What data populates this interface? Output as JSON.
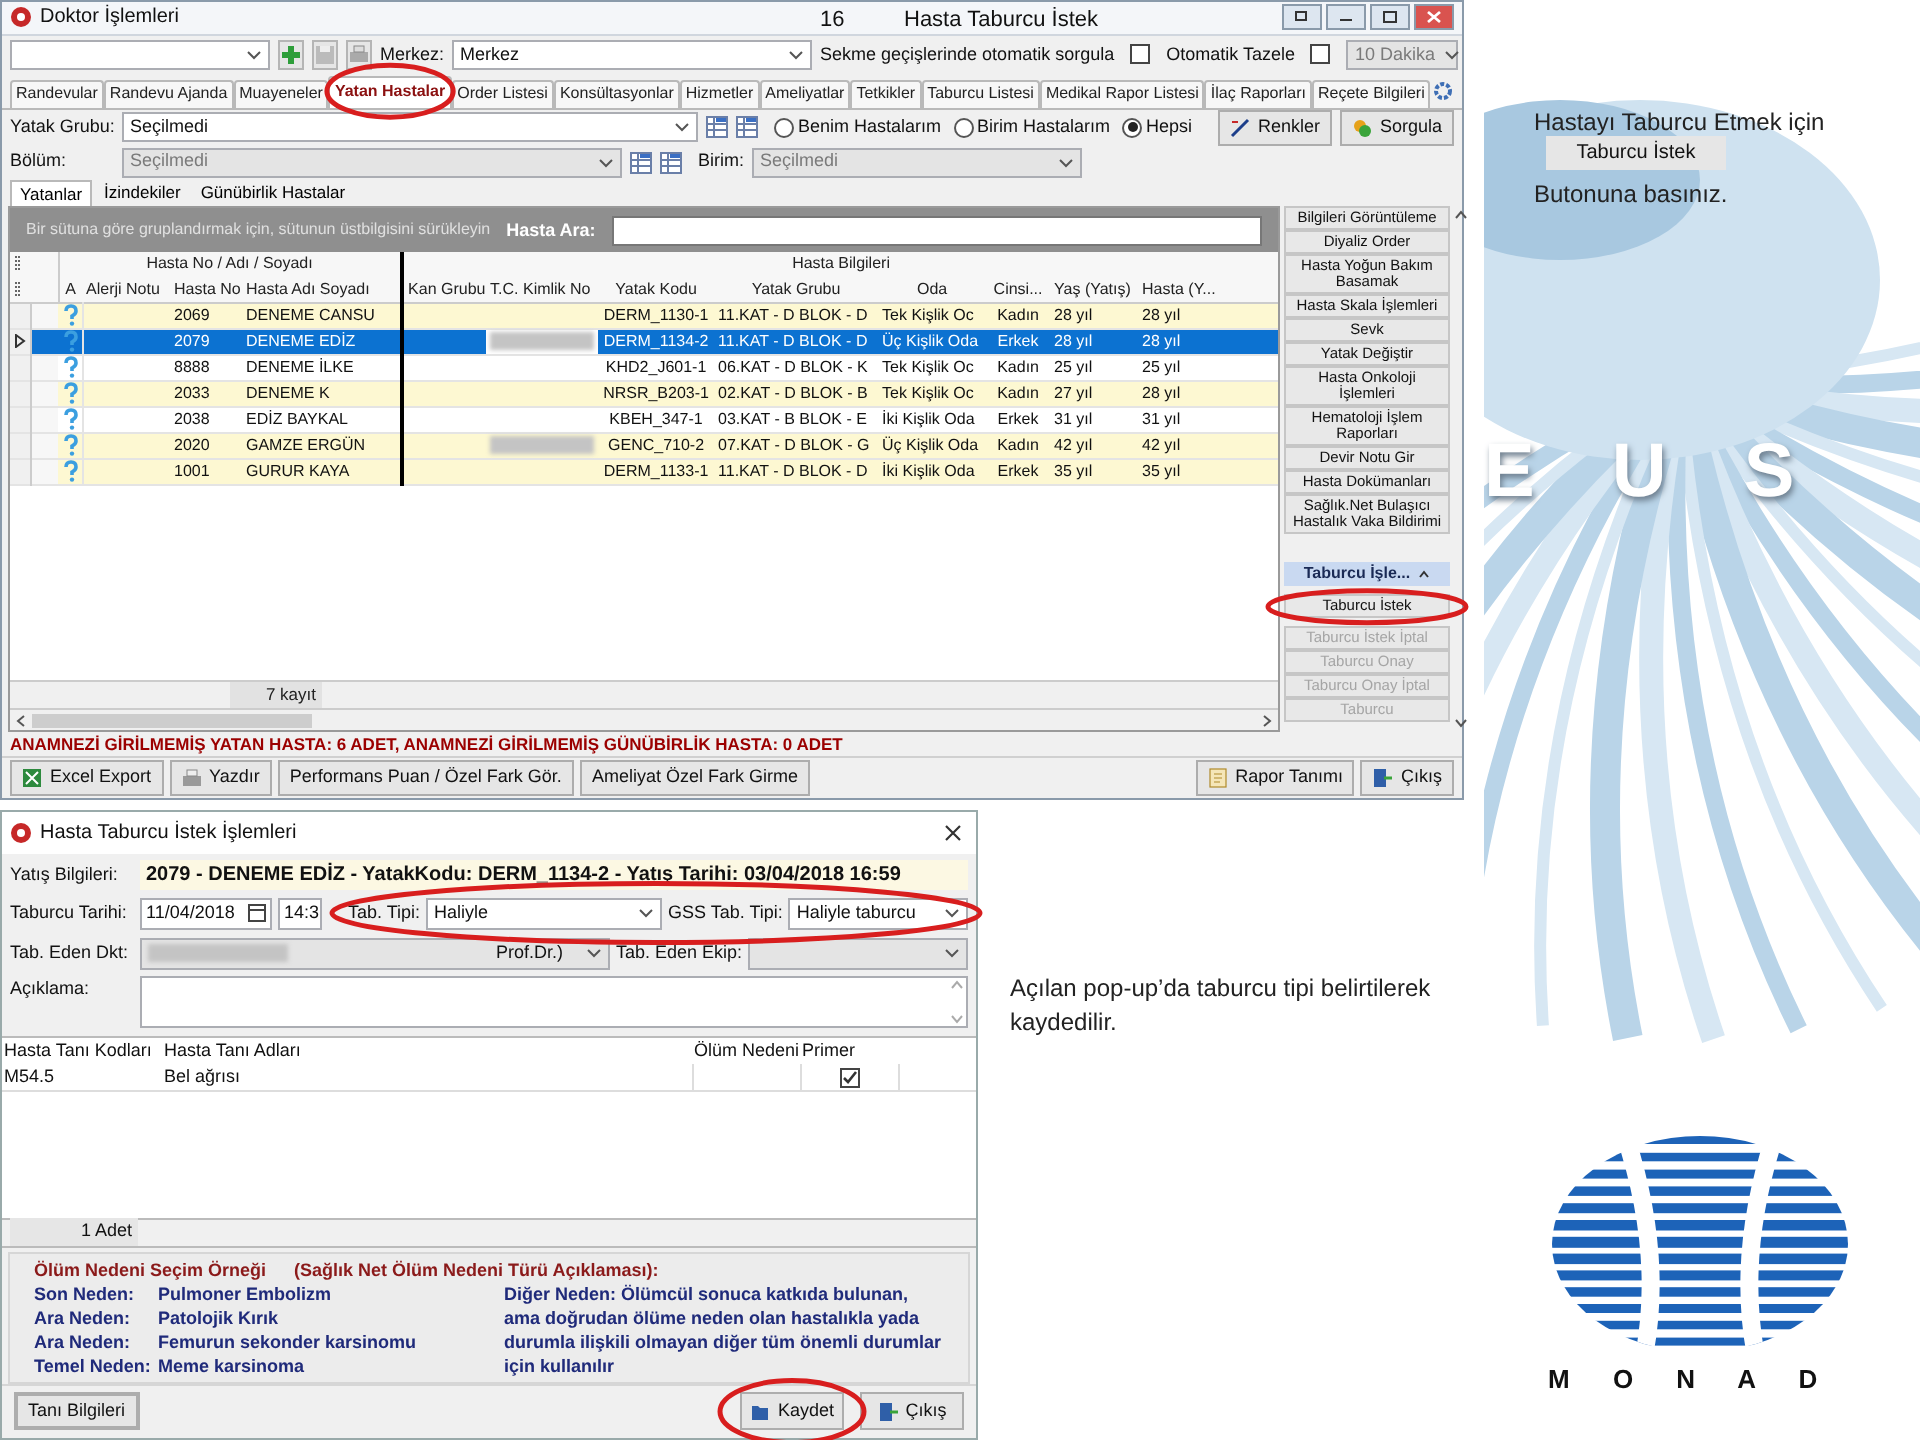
{
  "slide": {
    "page_number": "16",
    "title": "Hasta Taburcu İstek",
    "background_text": "E U S"
  },
  "main_window": {
    "title": "Doktor İşlemleri",
    "toolbar": {
      "merkez_label": "Merkez:",
      "merkez_value": "Merkez",
      "options": [
        {
          "label": "Sekme geçişlerinde otomatik sorgula",
          "checked": false
        },
        {
          "label": "Otomatik Tazele",
          "checked": false
        }
      ],
      "interval": {
        "value": "10 Dakika",
        "disabled": true
      }
    },
    "tabs": [
      {
        "label": "Randevular",
        "selected": false
      },
      {
        "label": "Randevu Ajanda",
        "selected": false
      },
      {
        "label": "Muayeneler",
        "selected": false
      },
      {
        "label": "Yatan Hastalar",
        "selected": true
      },
      {
        "label": "Order Listesi",
        "selected": false
      },
      {
        "label": "Konsültasyonlar",
        "selected": false
      },
      {
        "label": "Hizmetler",
        "selected": false
      },
      {
        "label": "Ameliyatlar",
        "selected": false
      },
      {
        "label": "Tetkikler",
        "selected": false
      },
      {
        "label": "Taburcu Listesi",
        "selected": false
      },
      {
        "label": "Medikal Rapor Listesi",
        "selected": false
      },
      {
        "label": "İlaç Raporları",
        "selected": false
      },
      {
        "label": "Reçete Bilgileri",
        "selected": false
      }
    ],
    "filters": {
      "yatak_grubu_label": "Yatak Grubu:",
      "yatak_grubu_value": "Seçilmedi",
      "radios": [
        {
          "label": "Benim Hastalarım",
          "selected": false
        },
        {
          "label": "Birim Hastalarım",
          "selected": false
        },
        {
          "label": "Hepsi",
          "selected": true
        }
      ],
      "buttons": [
        "Renkler",
        "Sorgula"
      ],
      "bolum_label": "Bölüm:",
      "bolum_value": "Seçilmedi",
      "birim_label": "Birim:",
      "birim_value": "Seçilmedi"
    },
    "sub_tabs": [
      {
        "label": "Yatanlar",
        "selected": true
      },
      {
        "label": "İzindekiler",
        "selected": false
      },
      {
        "label": "Günübirlik Hastalar",
        "selected": false
      }
    ],
    "grid": {
      "group_hint": "Bir sütuna göre gruplandırmak için, sütunun üstbilgisini sürükleyin",
      "search_label": "Hasta Ara:",
      "bands": [
        "Hasta No / Adı / Soyadı",
        "Hasta Bilgileri"
      ],
      "columns": [
        "A",
        "Alerji Notu",
        "Hasta No",
        "Hasta Adı Soyadı",
        "Kan Grubu",
        "T.C. Kimlik No",
        "Yatak Kodu",
        "Yatak Grubu",
        "Oda",
        "Cinsi...",
        "Yaş (Yatış)",
        "Hasta (Y..."
      ],
      "rows": [
        {
          "hasta_no": "2069",
          "name": "DENEME CANSU",
          "tc_hidden": false,
          "yatak_kodu": "DERM_1130-1",
          "yatak_grubu": "11.KAT - D BLOK - D",
          "oda": "Tek Kişlik Oc",
          "cinsi": "Kadın",
          "yas": "28 yıl",
          "hasta_yas": "28 yıl",
          "color": "#fdf8d2",
          "selected": false
        },
        {
          "hasta_no": "2079",
          "name": "DENEME EDİZ",
          "tc_hidden": true,
          "yatak_kodu": "DERM_1134-2",
          "yatak_grubu": "11.KAT - D BLOK - D",
          "oda": "Üç Kişlik Oda",
          "cinsi": "Erkek",
          "yas": "28 yıl",
          "hasta_yas": "28 yıl",
          "color": "#ffffff",
          "selected": true
        },
        {
          "hasta_no": "8888",
          "name": "DENEME İLKE",
          "tc_hidden": false,
          "yatak_kodu": "KHD2_J601-1",
          "yatak_grubu": "06.KAT - D BLOK - K",
          "oda": "Tek Kişlik Oc",
          "cinsi": "Kadın",
          "yas": "25 yıl",
          "hasta_yas": "25 yıl",
          "color": "#ffffff",
          "selected": false
        },
        {
          "hasta_no": "2033",
          "name": "DENEME K",
          "tc_hidden": false,
          "yatak_kodu": "NRSR_B203-1",
          "yatak_grubu": "02.KAT - D BLOK - B",
          "oda": "Tek Kişlik Oc",
          "cinsi": "Kadın",
          "yas": "27 yıl",
          "hasta_yas": "28 yıl",
          "color": "#fdf8d2",
          "selected": false
        },
        {
          "hasta_no": "2038",
          "name": "EDİZ BAYKAL",
          "tc_hidden": false,
          "yatak_kodu": "KBEH_347-1",
          "yatak_grubu": "03.KAT - B BLOK - E",
          "oda": "İki Kişlik Oda",
          "cinsi": "Erkek",
          "yas": "31 yıl",
          "hasta_yas": "31 yıl",
          "color": "#ffffff",
          "selected": false
        },
        {
          "hasta_no": "2020",
          "name": "GAMZE ERGÜN",
          "tc_hidden": true,
          "yatak_kodu": "GENC_710-2",
          "yatak_grubu": "07.KAT - D BLOK - G",
          "oda": "Üç Kişlik Oda",
          "cinsi": "Kadın",
          "yas": "42 yıl",
          "hasta_yas": "42 yıl",
          "color": "#fdf8d2",
          "selected": false
        },
        {
          "hasta_no": "1001",
          "name": "GURUR KAYA",
          "tc_hidden": false,
          "yatak_kodu": "DERM_1133-1",
          "yatak_grubu": "11.KAT - D BLOK - D",
          "oda": "İki Kişlik Oda",
          "cinsi": "Erkek",
          "yas": "35 yıl",
          "hasta_yas": "35 yıl",
          "color": "#fdf8d2",
          "selected": false
        }
      ],
      "footer": "7 kayıt"
    },
    "side_buttons": [
      {
        "kind": "button",
        "label": "Bilgileri Görüntüleme",
        "disabled": false
      },
      {
        "kind": "button",
        "label": "Diyaliz Order",
        "disabled": false
      },
      {
        "kind": "button",
        "label": "Hasta Yoğun Bakım Basamak",
        "disabled": false
      },
      {
        "kind": "button",
        "label": "Hasta Skala İşlemleri",
        "disabled": false
      },
      {
        "kind": "button",
        "label": "Sevk",
        "disabled": false
      },
      {
        "kind": "button",
        "label": "Yatak Değiştir",
        "disabled": false
      },
      {
        "kind": "button",
        "label": "Hasta Onkoloji İşlemleri",
        "disabled": false
      },
      {
        "kind": "button",
        "label": "Hematoloji İşlem Raporları",
        "disabled": false
      },
      {
        "kind": "button",
        "label": "Devir Notu Gir",
        "disabled": false
      },
      {
        "kind": "button",
        "label": "Hasta Dokümanları",
        "disabled": false
      },
      {
        "kind": "button",
        "label": "Sağlık.Net Bulaşıcı Hastalık Vaka Bildirimi",
        "disabled": false
      },
      {
        "kind": "group",
        "label": "Taburcu İşle..."
      },
      {
        "kind": "button",
        "label": "Taburcu İstek",
        "disabled": false
      },
      {
        "kind": "button",
        "label": "Taburcu İstek İptal",
        "disabled": true
      },
      {
        "kind": "button",
        "label": "Taburcu Onay",
        "disabled": true
      },
      {
        "kind": "button",
        "label": "Taburcu Onay İptal",
        "disabled": true
      },
      {
        "kind": "button",
        "label": "Taburcu",
        "disabled": true
      }
    ],
    "status": "ANAMNEZİ GİRİLMEMİŞ YATAN HASTA: 6 ADET, ANAMNEZİ GİRİLMEMİŞ GÜNÜBİRLİK HASTA: 0 ADET",
    "bottom_buttons_left": [
      "Excel Export",
      "Yazdır",
      "Performans Puan / Özel Fark Gör.",
      "Ameliyat Özel Fark Girme"
    ],
    "bottom_buttons_right": [
      "Rapor Tanımı",
      "Çıkış"
    ]
  },
  "dialog": {
    "title": "Hasta Taburcu İstek İşlemleri",
    "yatis_label": "Yatış Bilgileri:",
    "yatis_value": "2079 - DENEME EDİZ - YatakKodu: DERM_1134-2 - Yatış Tarihi: 03/04/2018 16:59",
    "taburcu_tarihi_label": "Taburcu Tarihi:",
    "taburcu_tarihi": "11/04/2018",
    "time": "14:3",
    "tab_tipi_label": "Tab. Tipi:",
    "tab_tipi": "Haliyle",
    "gss_label": "GSS Tab. Tipi:",
    "gss_value": "Haliyle taburcu",
    "doktor_label": "Tab. Eden Dkt:",
    "doktor_value": "Prof.Dr.)",
    "ekip_label": "Tab. Eden Ekip:",
    "aciklama_label": "Açıklama:",
    "diagnosis": {
      "columns": [
        "Hasta Tanı Kodları",
        "Hasta Tanı Adları",
        "Ölüm Nedeni",
        "Primer"
      ],
      "rows": [
        {
          "code": "M54.5",
          "name": "Bel ağrısı",
          "primer": true
        }
      ],
      "footer": "1 Adet"
    },
    "info": {
      "title": "Ölüm Nedeni Seçim Örneği",
      "subtitle": "(Sağlık Net Ölüm Nedeni Türü Açıklaması):",
      "items": [
        {
          "label": "Son Neden:",
          "value": "Pulmoner Embolizm"
        },
        {
          "label": "Ara Neden:",
          "value": "Patolojik Kırık"
        },
        {
          "label": "Ara Neden:",
          "value": "Femurun sekonder karsinomu"
        },
        {
          "label": "Temel Neden:",
          "value": "Meme karsinoma"
        }
      ],
      "note": "Diğer Neden: Ölümcül sonuca katkıda bulunan, ama doğrudan ölüme neden olan hastalıkla yada durumla ilişkili olmayan diğer tüm önemli durumlar için kullanılır"
    },
    "buttons_left": [
      "Tanı Bilgileri"
    ],
    "buttons_right": [
      "Kaydet",
      "Çıkış"
    ]
  },
  "annotations": {
    "instruction_before": "Hastayı Taburcu Etmek için",
    "button": "Taburcu İstek",
    "instruction_after": "Butonuna basınız.",
    "popup_note": "Açılan pop-up’da taburcu tipi belirtilerek kaydedilir."
  },
  "logo": {
    "text": "M O N A D"
  }
}
